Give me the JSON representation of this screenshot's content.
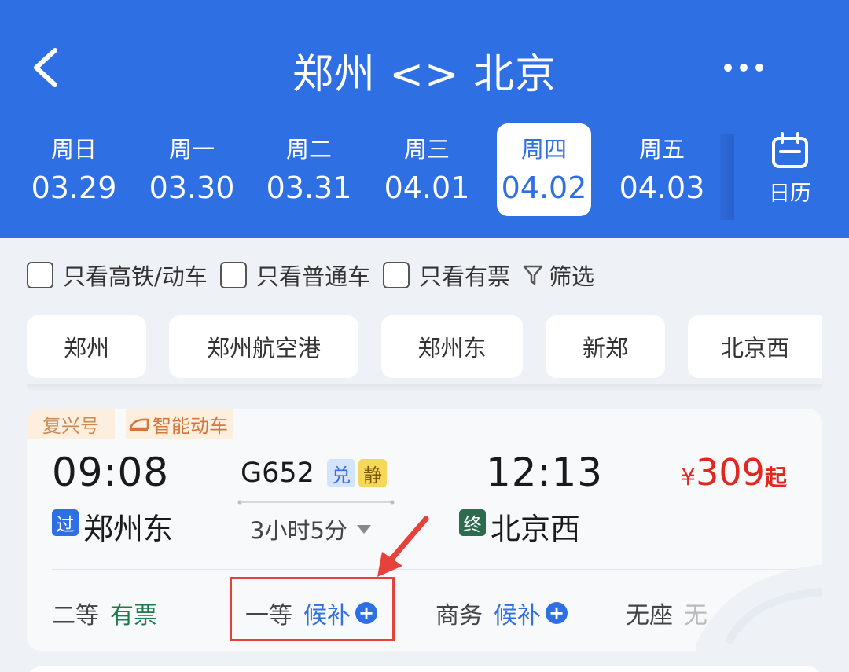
{
  "header": {
    "title": "郑州 <> 北京",
    "back_icon": "chevron-left-icon",
    "more_icon": "more-dots-icon"
  },
  "dates": [
    {
      "weekday": "周日",
      "date": "03.29",
      "active": false
    },
    {
      "weekday": "周一",
      "date": "03.30",
      "active": false
    },
    {
      "weekday": "周二",
      "date": "03.31",
      "active": false
    },
    {
      "weekday": "周三",
      "date": "04.01",
      "active": false
    },
    {
      "weekday": "周四",
      "date": "04.02",
      "active": true
    },
    {
      "weekday": "周五",
      "date": "04.03",
      "active": false
    }
  ],
  "calendar": {
    "label": "日历",
    "icon": "calendar-icon"
  },
  "filters": {
    "only_high_speed": "只看高铁/动车",
    "only_normal": "只看普通车",
    "only_available": "只看有票",
    "filter_label": "筛选"
  },
  "stations": [
    "郑州",
    "郑州航空港",
    "郑州东",
    "新郑",
    "北京西"
  ],
  "train": {
    "tag_brand": "复兴号",
    "tag_smart": "智能动车",
    "departure_time": "09:08",
    "arrival_time": "12:13",
    "train_number": "G652",
    "badge_exchange": "兑",
    "badge_quiet": "静",
    "duration": "3小时5分",
    "departure_badge": "过",
    "departure_station": "郑州东",
    "arrival_badge": "终",
    "arrival_station": "北京西",
    "price_currency": "¥",
    "price_value": "309",
    "price_suffix": "起",
    "seats": [
      {
        "class": "二等",
        "status": "有票",
        "type": "avail"
      },
      {
        "class": "一等",
        "status": "候补",
        "type": "wait"
      },
      {
        "class": "商务",
        "status": "候补",
        "type": "wait"
      },
      {
        "class": "无座",
        "status": "无",
        "type": "none"
      }
    ]
  },
  "colors": {
    "primary": "#2f6fe4",
    "price": "#e0281f",
    "available": "#1f7a4d",
    "highlight": "#e8403a"
  }
}
